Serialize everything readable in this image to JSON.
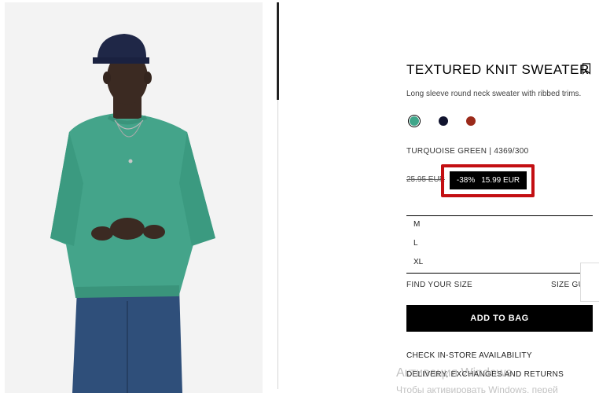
{
  "product": {
    "title": "TEXTURED KNIT SWEATER",
    "description": "Long sleeve round neck sweater with ribbed trims.",
    "color_ref": "TURQUOISE GREEN | 4369/300",
    "old_price": "25.95 EUR",
    "discount": "-38%",
    "price": "15.99 EUR"
  },
  "colors": [
    {
      "name": "turquoise-green",
      "hex": "#3fa68a",
      "selected": true
    },
    {
      "name": "navy",
      "hex": "#10132e",
      "selected": false
    },
    {
      "name": "rust-red",
      "hex": "#9b2a1a",
      "selected": false
    }
  ],
  "highlight_color": "#c30f12",
  "sizes": [
    "M",
    "L",
    "XL"
  ],
  "size_links": {
    "find_size": "FIND YOUR SIZE",
    "size_guide": "SIZE GUIDE"
  },
  "add_to_bag": "ADD TO BAG",
  "links": {
    "store_availability": "CHECK IN-STORE AVAILABILITY",
    "delivery": "DELIVERY, EXCHANGES AND RETURNS"
  },
  "icons": {
    "bookmark": "bookmark-icon"
  },
  "watermark": {
    "line1": "Активация Windows",
    "line2": "Чтобы активировать Windows, перей"
  }
}
